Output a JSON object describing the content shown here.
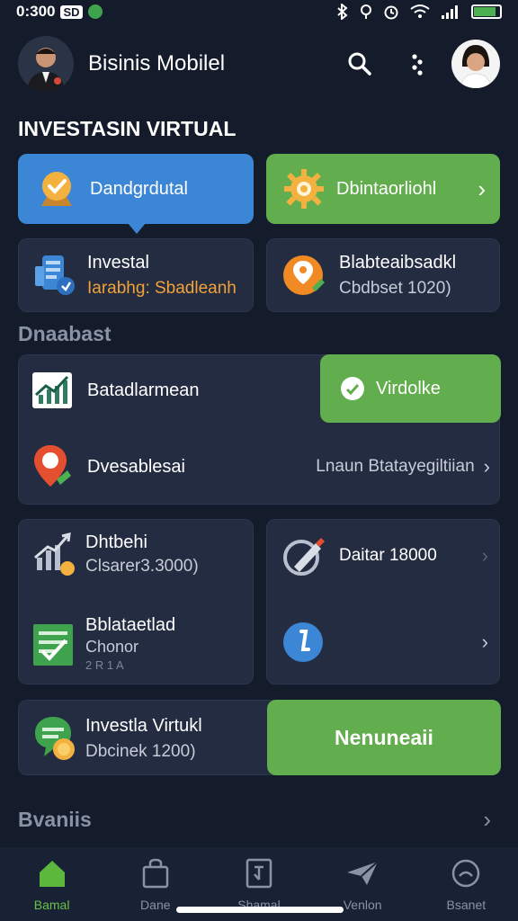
{
  "status": {
    "time": "0:300",
    "sim": "SD"
  },
  "header": {
    "title": "Bisinis Mobilel"
  },
  "section1": {
    "title": "INVESTASIN VIRTUAL"
  },
  "tiles": {
    "blue_button": "Dandgrdutal",
    "green_button": "Dbintaorliohl",
    "investal_title": "Investal",
    "investal_sub": "Iarabhg: Sbadleanh",
    "blast_title": "Blabteaibsadkl",
    "blast_sub": "Cbdbset 1020)"
  },
  "section2": {
    "title": "Dnaabast"
  },
  "list1": {
    "row1_label": "Batadlarmean",
    "verify_button": "Virdolke",
    "row2_label": "Dvesablesai",
    "row2_value": "Lnaun Btatayegiltiian"
  },
  "grid": {
    "a_title": "Dhtbehi",
    "a_sub": "Clsarer3.3000)",
    "b_title": "Daitar 18000",
    "c_title": "Bblataetlad",
    "c_sub": "Chonor",
    "c_sub2": "2 R 1 A"
  },
  "promo": {
    "title": "Investla Virtukl",
    "sub": "Dbcinek 1200)",
    "button": "Nenuneaii"
  },
  "section3": {
    "title": "Bvaniis"
  },
  "nav": {
    "items": [
      {
        "label": "Bamal"
      },
      {
        "label": "Dane"
      },
      {
        "label": "Shamal"
      },
      {
        "label": "Venlon"
      },
      {
        "label": "Bsanet"
      }
    ]
  },
  "colors": {
    "background": "#141b2b",
    "card": "#232c40",
    "accent_blue": "#3c86d6",
    "accent_green": "#62ad4e",
    "accent_orange": "#f2a23a"
  }
}
